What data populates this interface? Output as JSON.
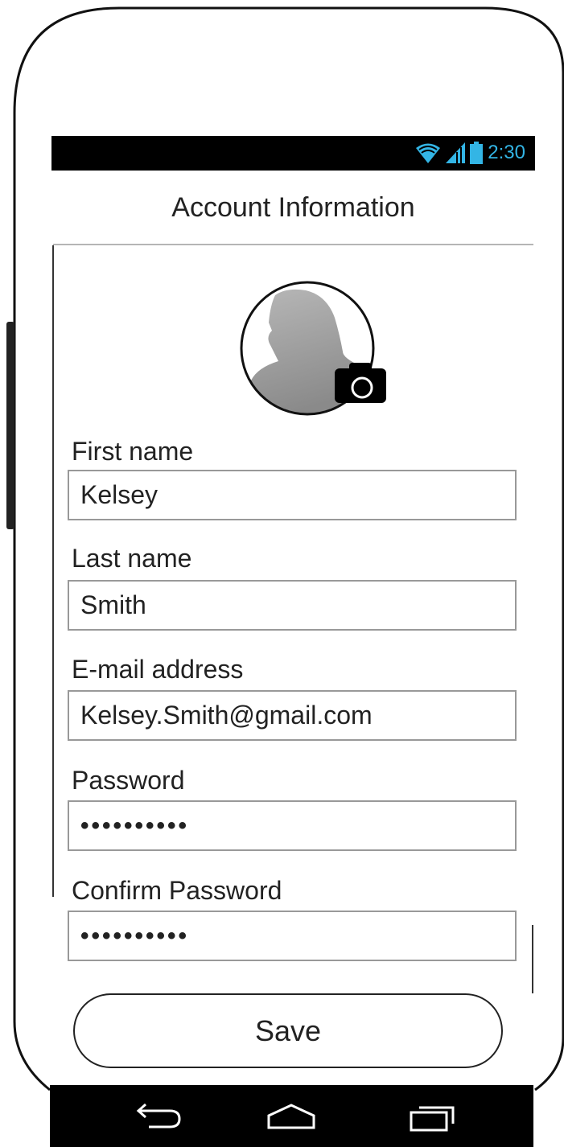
{
  "status_bar": {
    "time": "2:30",
    "icons": [
      "wifi-icon",
      "signal-icon",
      "battery-icon"
    ],
    "accent": "#33b5e5"
  },
  "header": {
    "title": "Account Information"
  },
  "avatar": {
    "icon": "profile-silhouette-icon",
    "action_icon": "camera-icon"
  },
  "form": {
    "first_name": {
      "label": "First name",
      "value": "Kelsey"
    },
    "last_name": {
      "label": "Last name",
      "value": "Smith"
    },
    "email": {
      "label": "E-mail address",
      "value": "Kelsey.Smith@gmail.com"
    },
    "password": {
      "label": "Password",
      "value": "••••••••••"
    },
    "confirm_password": {
      "label": "Confirm Password",
      "value": "••••••••••"
    }
  },
  "actions": {
    "save_label": "Save"
  },
  "nav_bar": {
    "icons": [
      "back-icon",
      "home-icon",
      "recents-icon"
    ]
  }
}
